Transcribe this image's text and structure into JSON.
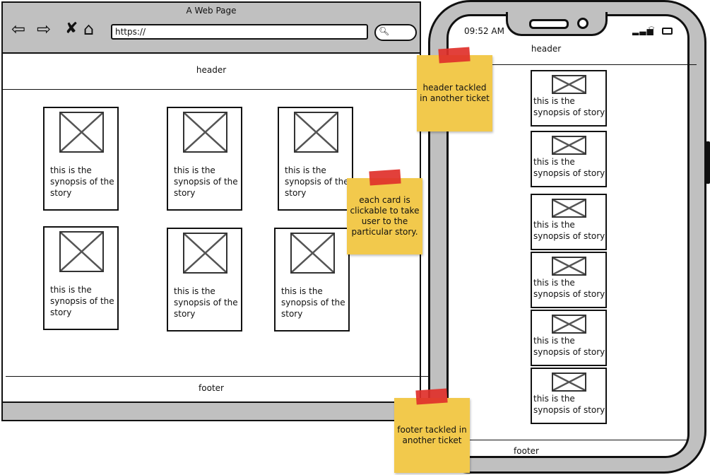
{
  "desktop": {
    "window_title": "A Web Page",
    "url": "https://",
    "header": "header",
    "footer": "footer",
    "cards": [
      {
        "text": "this is the synopsis of the story"
      },
      {
        "text": "this is the synopsis of the story"
      },
      {
        "text": "this is the synopsis of the story"
      },
      {
        "text": "this is the synopsis of the story"
      },
      {
        "text": "this is the synopsis of the story"
      },
      {
        "text": "this is the synopsis of the story"
      }
    ]
  },
  "mobile": {
    "time": "09:52 AM",
    "header": "header",
    "footer": "footer",
    "cards": [
      {
        "text": "this is the synopsis of story"
      },
      {
        "text": "this is the synopsis of story"
      },
      {
        "text": "this is the synopsis of story"
      },
      {
        "text": "this is the synopsis of story"
      },
      {
        "text": "this is the synopsis of story"
      },
      {
        "text": "this is the synopsis of story"
      }
    ]
  },
  "notes": [
    {
      "text": "header tackled in another ticket"
    },
    {
      "text": "each card is clickable to take user to the particular story."
    },
    {
      "text": "footer tackled in another ticket"
    }
  ],
  "colors": {
    "chrome": "#c0c0c0",
    "sticky": "#f2c94c",
    "tape": "#e0302a"
  }
}
